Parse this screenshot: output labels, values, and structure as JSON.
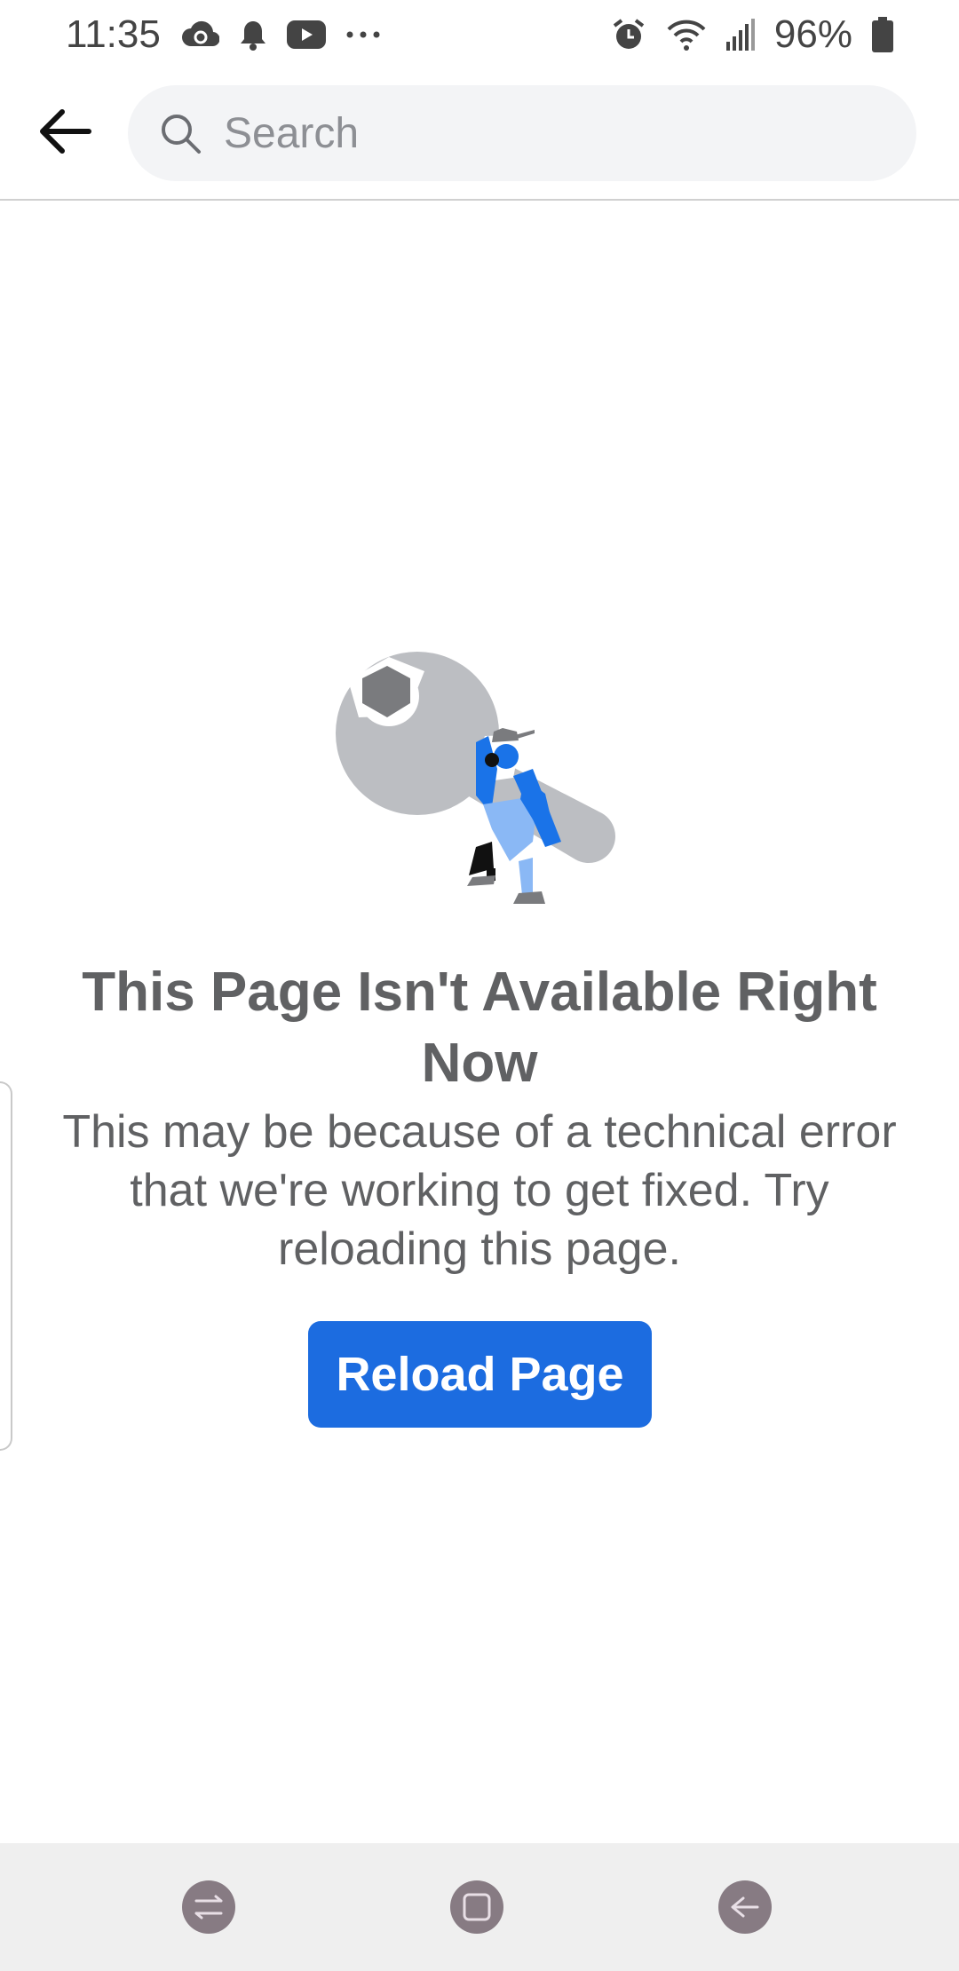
{
  "status_bar": {
    "time": "11:35",
    "battery": "96%",
    "icons": [
      "sync-cloud-icon",
      "notification-bell-icon",
      "youtube-icon",
      "more-dots-icon",
      "alarm-icon",
      "wifi-icon",
      "signal-icon",
      "battery-icon"
    ]
  },
  "header": {
    "back_icon": "back-arrow-icon",
    "search_placeholder": "Search"
  },
  "error": {
    "illustration": "worker-carrying-wrench",
    "title": "This Page Isn't Available Right Now",
    "message": "This may be because of a technical error that we're working to get fixed. Try reloading this page.",
    "button_label": "Reload Page"
  },
  "colors": {
    "primary": "#1c6ce0",
    "text": "#606163",
    "search_bg": "#f3f4f6"
  },
  "nav_bar": {
    "buttons": [
      "recent-apps-icon",
      "home-icon",
      "back-icon"
    ]
  }
}
